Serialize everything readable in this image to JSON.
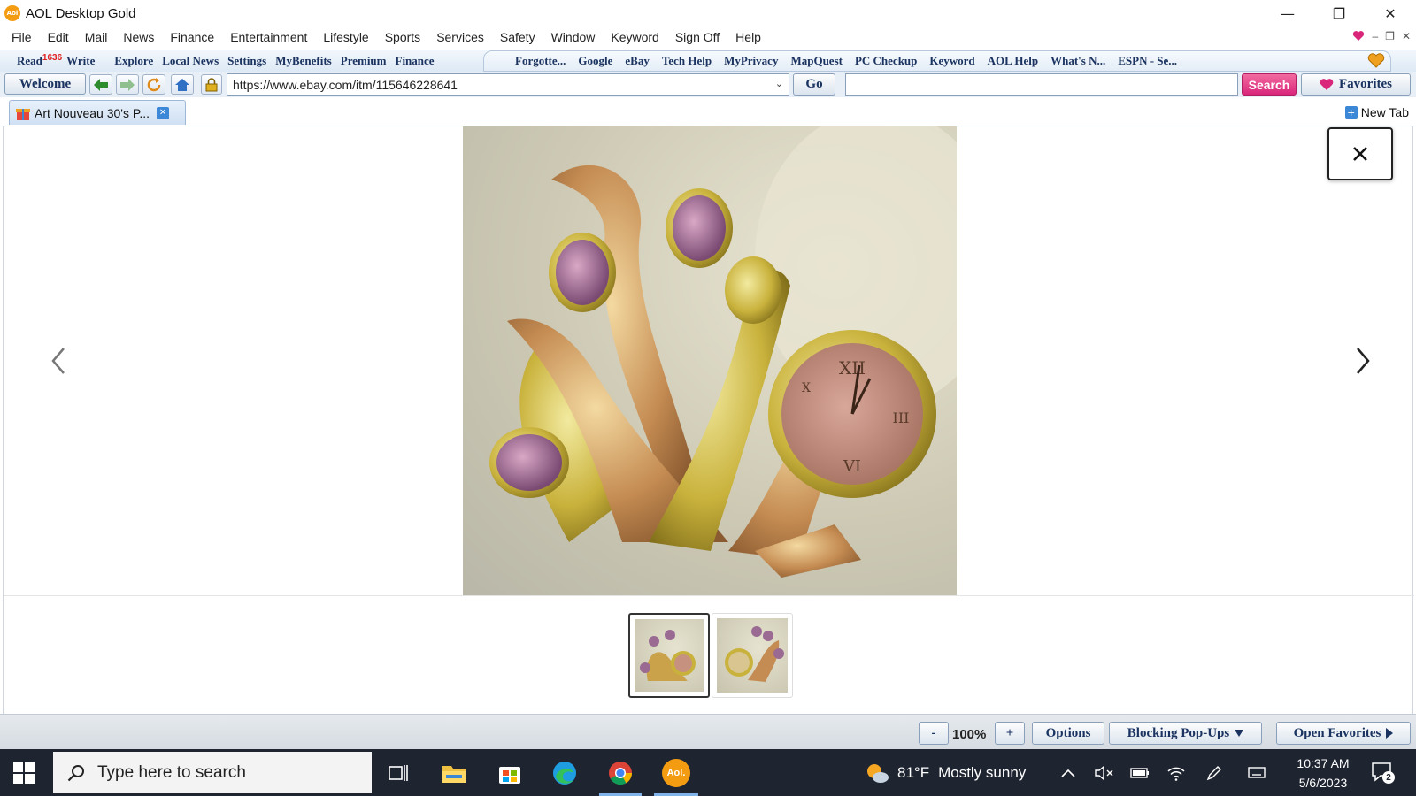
{
  "window": {
    "title": "AOL Desktop Gold",
    "logo_text": "Aol"
  },
  "menu": [
    "File",
    "Edit",
    "Mail",
    "News",
    "Finance",
    "Entertainment",
    "Lifestyle",
    "Sports",
    "Services",
    "Safety",
    "Window",
    "Keyword",
    "Sign Off",
    "Help"
  ],
  "quickbar": {
    "left": [
      {
        "label": "Read",
        "badge": "1636"
      },
      {
        "label": "Write"
      },
      {
        "label": "Explore"
      },
      {
        "label": "Local News"
      },
      {
        "label": "Settings"
      },
      {
        "label": "MyBenefits"
      },
      {
        "label": "Premium"
      },
      {
        "label": "Finance"
      }
    ],
    "right": [
      "Forgotte...",
      "Google",
      "eBay",
      "Tech Help",
      "MyPrivacy",
      "MapQuest",
      "PC Checkup",
      "Keyword",
      "AOL Help",
      "What's N...",
      "ESPN - Se..."
    ]
  },
  "nav": {
    "welcome_label": "Welcome",
    "url": "https://www.ebay.com/itm/115646228641",
    "go_label": "Go",
    "search_value": "",
    "search_label": "Search",
    "favorites_label": "Favorites"
  },
  "tabs": [
    {
      "label": "Art Nouveau 30's P..."
    }
  ],
  "new_tab_label": "New Tab",
  "status": {
    "zoom_minus": "-",
    "zoom": "100%",
    "zoom_plus": "+",
    "options_label": "Options",
    "popups_label": "Blocking Pop-Ups",
    "open_favorites_label": "Open Favorites"
  },
  "taskbar": {
    "search_placeholder": "Type here to search",
    "weather_temp": "81°F",
    "weather_text": "Mostly sunny",
    "time": "10:37 AM",
    "date": "5/6/2023",
    "notification_count": "2",
    "aol_label": "Aol."
  },
  "colors": {
    "accent": "#1a3360",
    "search_pink": "#d9257a",
    "taskbar": "#1e2430"
  }
}
